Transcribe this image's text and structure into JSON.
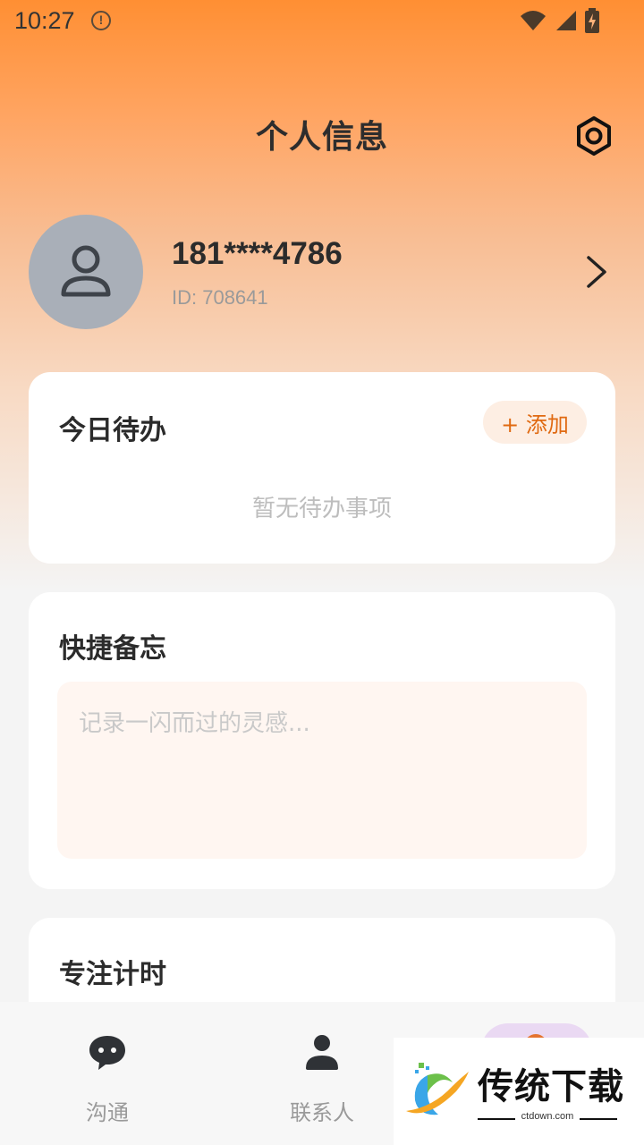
{
  "status_bar": {
    "time": "10:27",
    "info_icon": "info-circle-icon",
    "icons": [
      "wifi-icon",
      "signal-icon",
      "battery-charging-icon"
    ]
  },
  "header": {
    "title": "个人信息",
    "settings_icon": "settings-hexagon-icon"
  },
  "profile": {
    "phone": "181****4786",
    "id_text": "ID: 708641",
    "avatar_icon": "user-icon",
    "arrow_icon": "chevron-right-icon"
  },
  "todo": {
    "title": "今日待办",
    "add_label": "+ 添加",
    "empty_text": "暂无待办事项"
  },
  "memo": {
    "title": "快捷备忘",
    "value": "",
    "placeholder": "记录一闪而过的灵感..."
  },
  "focus": {
    "title": "专注计时"
  },
  "tab_bar": {
    "tabs": [
      {
        "label": "沟通",
        "icon": "chat-bubble-icon"
      },
      {
        "label": "联系人",
        "icon": "person-icon"
      },
      {
        "label": "",
        "icon": "profile-icon",
        "active": true
      }
    ],
    "active_color": "#e4732f"
  },
  "watermark": {
    "brand": "传统下载",
    "domain": "ctdown.com"
  },
  "colors": {
    "accent": "#ff8f33",
    "add_button_text": "#e06a12",
    "add_button_bg": "#fdeee3",
    "memo_bg": "#fff6f1"
  }
}
